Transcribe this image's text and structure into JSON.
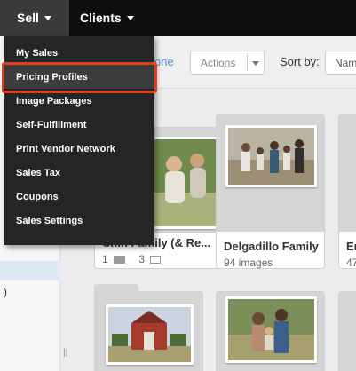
{
  "nav": {
    "sell_label": "Sell",
    "clients_label": "Clients"
  },
  "menu": {
    "items": [
      {
        "label": "My Sales"
      },
      {
        "label": "Pricing Profiles"
      },
      {
        "label": "Image Packages"
      },
      {
        "label": "Self-Fulfillment"
      },
      {
        "label": "Print Vendor Network"
      },
      {
        "label": "Sales Tax"
      },
      {
        "label": "Coupons"
      },
      {
        "label": "Sales Settings"
      }
    ],
    "active_index": 1,
    "highlight_color": "#e23d1f"
  },
  "toolbar": {
    "done_link": "one",
    "actions_label": "Actions",
    "sort_by_label": "Sort by:",
    "sort_value": "Nam"
  },
  "left_panel": {
    "paren_text": ")",
    "grip": "||"
  },
  "galleries": [
    {
      "title": "Chin Family (& Re...",
      "folders": "1",
      "images": "3"
    },
    {
      "title": "Delgadillo Family",
      "sub": "94 images"
    },
    {
      "title": "En",
      "sub": "47"
    }
  ],
  "colors": {
    "nav_bg": "#0e0e0e",
    "menu_bg": "#252525",
    "link": "#4a90d9"
  }
}
